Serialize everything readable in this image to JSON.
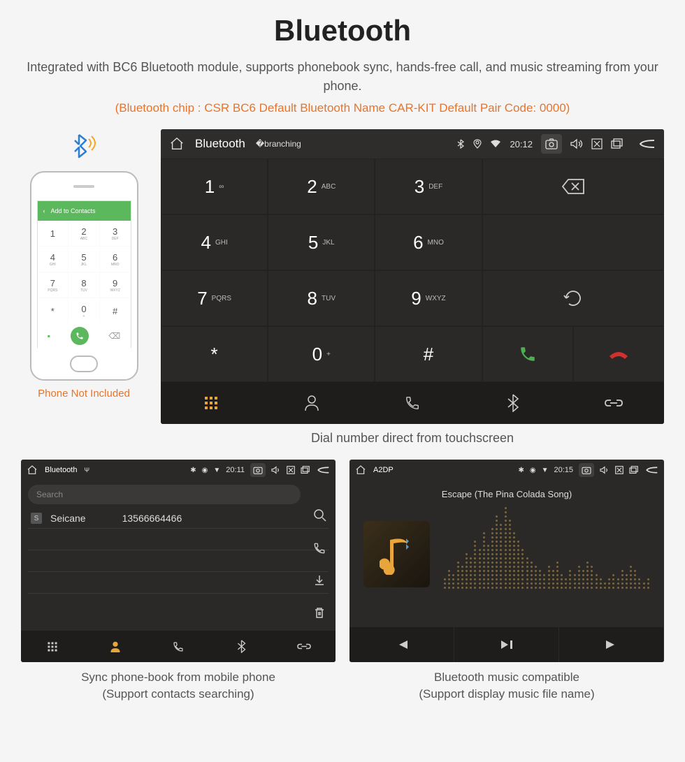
{
  "header": {
    "title": "Bluetooth",
    "subtitle": "Integrated with BC6 Bluetooth module, supports phonebook sync, hands-free call, and music streaming from your phone.",
    "specs": "(Bluetooth chip : CSR BC6    Default Bluetooth Name CAR-KIT    Default Pair Code: 0000)"
  },
  "phone": {
    "header_label": "Add to Contacts",
    "disclaimer": "Phone Not Included",
    "keys": [
      {
        "n": "1",
        "s": ""
      },
      {
        "n": "2",
        "s": "ABC"
      },
      {
        "n": "3",
        "s": "DEF"
      },
      {
        "n": "4",
        "s": "GHI"
      },
      {
        "n": "5",
        "s": "JKL"
      },
      {
        "n": "6",
        "s": "MNO"
      },
      {
        "n": "7",
        "s": "PQRS"
      },
      {
        "n": "8",
        "s": "TUV"
      },
      {
        "n": "9",
        "s": "WXYZ"
      },
      {
        "n": "*",
        "s": ""
      },
      {
        "n": "0",
        "s": "+"
      },
      {
        "n": "#",
        "s": ""
      }
    ]
  },
  "main_screen": {
    "status_title": "Bluetooth",
    "time": "20:12",
    "keys": [
      {
        "n": "1",
        "s": "∞"
      },
      {
        "n": "2",
        "s": "ABC"
      },
      {
        "n": "3",
        "s": "DEF"
      },
      {
        "n": "4",
        "s": "GHI"
      },
      {
        "n": "5",
        "s": "JKL"
      },
      {
        "n": "6",
        "s": "MNO"
      },
      {
        "n": "7",
        "s": "PQRS"
      },
      {
        "n": "8",
        "s": "TUV"
      },
      {
        "n": "9",
        "s": "WXYZ"
      },
      {
        "n": "*",
        "s": ""
      },
      {
        "n": "0",
        "s": "+"
      },
      {
        "n": "#",
        "s": ""
      }
    ],
    "caption": "Dial number direct from touchscreen"
  },
  "contacts_screen": {
    "status_title": "Bluetooth",
    "time": "20:11",
    "search_placeholder": "Search",
    "contact_badge": "S",
    "contact_name": "Seicane",
    "contact_number": "13566664466",
    "caption_line1": "Sync phone-book from mobile phone",
    "caption_line2": "(Support contacts searching)"
  },
  "music_screen": {
    "status_title": "A2DP",
    "time": "20:15",
    "song_title": "Escape (The Pina Colada Song)",
    "caption_line1": "Bluetooth music compatible",
    "caption_line2": "(Support display music file name)"
  },
  "colors": {
    "accent": "#e8742c",
    "call_green": "#4caf50",
    "hangup_red": "#d32f2f",
    "contact_active": "#e8a53c"
  }
}
